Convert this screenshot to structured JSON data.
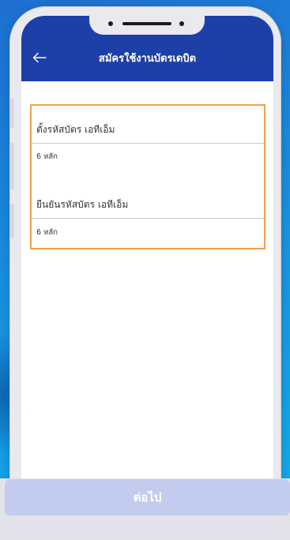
{
  "header": {
    "title": "สมัครใช้งานบัตรเดบิต",
    "back_icon": "arrow-left-icon"
  },
  "form": {
    "pin_field": {
      "label": "ตั้งรหัสบัตร เอทีเอ็ม",
      "hint": "6 หลัก"
    },
    "confirm_pin_field": {
      "label": "ยืนยันรหัสบัตร เอทีเอ็ม",
      "hint": "6 หลัก"
    }
  },
  "footer": {
    "next_label": "ต่อไป"
  },
  "colors": {
    "header_bg": "#1d3fa8",
    "highlight_border": "#f0a14a",
    "button_bg": "#c3ccef"
  }
}
